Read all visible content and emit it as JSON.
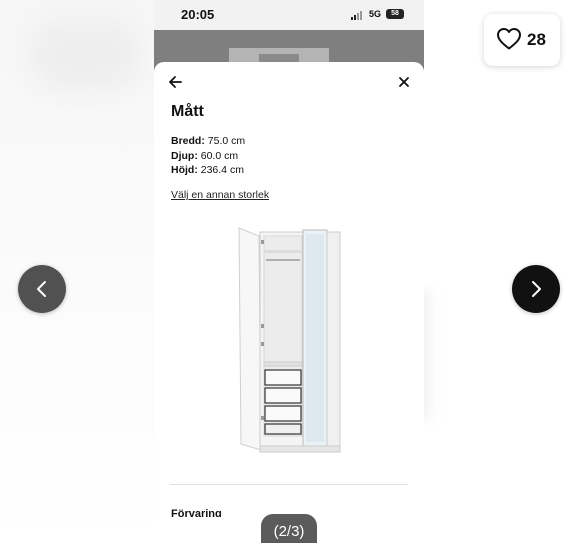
{
  "status_bar": {
    "time": "20:05",
    "network": "5G",
    "battery": "58"
  },
  "sheet": {
    "title": "Mått",
    "dimensions": [
      {
        "label": "Bredd:",
        "value": "75.0 cm"
      },
      {
        "label": "Djup:",
        "value": "60.0 cm"
      },
      {
        "label": "Höjd:",
        "value": "236.4 cm"
      }
    ],
    "change_size_link": "Välj en annan storlek",
    "next_heading": "Förvaring"
  },
  "image_counter": "(2/3)",
  "favorites": {
    "count": "28"
  },
  "icons": {
    "back": "arrow-left-icon",
    "close": "close-icon",
    "prev": "chevron-left-icon",
    "next": "chevron-right-icon",
    "favorite": "heart-icon"
  },
  "colors": {
    "prev_button": "#515151",
    "next_button": "#111111",
    "counter_bg": "#5b5b5b"
  }
}
